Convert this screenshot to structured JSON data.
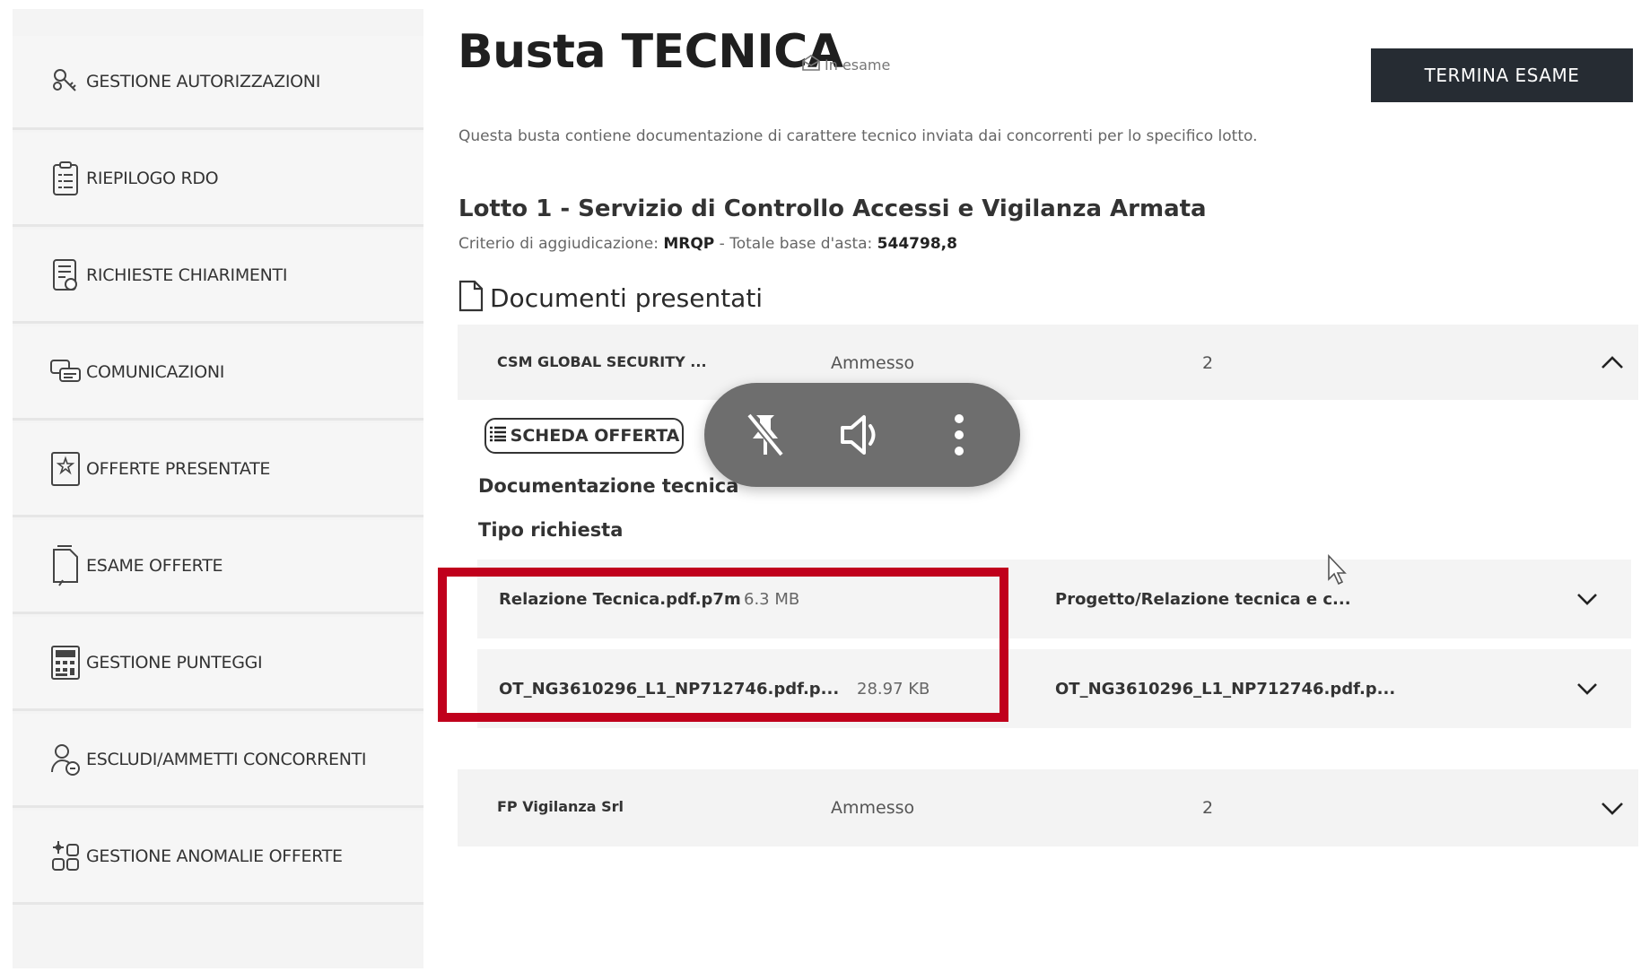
{
  "sidebar": {
    "items": [
      {
        "label": "GESTIONE AUTORIZZAZIONI",
        "icon": "keys-icon"
      },
      {
        "label": "RIEPILOGO RDO",
        "icon": "clipboard-icon"
      },
      {
        "label": "RICHIESTE CHIARIMENTI",
        "icon": "document-question-icon"
      },
      {
        "label": "COMUNICAZIONI",
        "icon": "chat-bubbles-icon"
      },
      {
        "label": "OFFERTE PRESENTATE",
        "icon": "document-star-icon"
      },
      {
        "label": "ESAME OFFERTE",
        "icon": "document-search-icon"
      },
      {
        "label": "GESTIONE PUNTEGGI",
        "icon": "calculator-icon"
      },
      {
        "label": "ESCLUDI/AMMETTI CONCORRENTI",
        "icon": "users-icon"
      },
      {
        "label": "GESTIONE ANOMALIE OFFERTE",
        "icon": "anomaly-icon"
      }
    ]
  },
  "header": {
    "title": "Busta TECNICA",
    "status": "In esame",
    "action_label": "TERMINA ESAME",
    "description": "Questa busta contiene documentazione di carattere tecnico inviata dai concorrenti per lo specifico lotto."
  },
  "lotto": {
    "title": "Lotto 1 - Servizio di Controllo Accessi e Vigilanza Armata",
    "criterion_label": "Criterio di aggiudicazione:",
    "criterion_value": "MRQP",
    "separator": " - ",
    "base_label": "Totale base d'asta:",
    "base_value": "544798,8"
  },
  "documents": {
    "heading": "Documenti presentati",
    "competitors": [
      {
        "name": "CSM GLOBAL SECURITY ...",
        "status": "Ammesso",
        "count": "2",
        "expanded": true
      },
      {
        "name": "FP Vigilanza Srl",
        "status": "Ammesso",
        "count": "2",
        "expanded": false
      }
    ],
    "scheda_label": "SCHEDA OFFERTA",
    "section_label": "Documentazione tecnica",
    "request_label": "Tipo richiesta",
    "files": [
      {
        "name": "Relazione Tecnica.pdf.p7m",
        "size": "6.3 MB",
        "type": "Progetto/Relazione tecnica e c..."
      },
      {
        "name": "OT_NG3610296_L1_NP712746.pdf.p...",
        "size": "28.97 KB",
        "type": "OT_NG3610296_L1_NP712746.pdf.p..."
      }
    ]
  },
  "media_controls": {
    "icons": [
      "unpin-icon",
      "volume-icon",
      "more-vertical-icon"
    ]
  },
  "colors": {
    "highlight": "#c0001c",
    "primary_button": "#262c33",
    "sidebar_bg": "#f4f4f4",
    "media_bg": "#6e6e6e"
  }
}
